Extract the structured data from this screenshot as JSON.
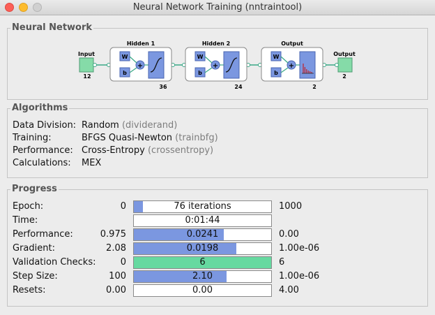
{
  "window": {
    "title": "Neural Network Training (nntraintool)"
  },
  "network": {
    "legend": "Neural Network",
    "input": {
      "label": "Input",
      "size": "12"
    },
    "layers": [
      {
        "label": "Hidden 1",
        "size": "36",
        "transfer": "sigmoid"
      },
      {
        "label": "Hidden 2",
        "size": "24",
        "transfer": "sigmoid"
      },
      {
        "label": "Output",
        "size": "2",
        "transfer": "softmax"
      }
    ],
    "output": {
      "label": "Output",
      "size": "2"
    },
    "weight_label": "W",
    "bias_label": "b",
    "colors": {
      "io_box": "#85dba8",
      "block": "#7b97e0",
      "connector": "#3aa886"
    }
  },
  "algorithms": {
    "legend": "Algorithms",
    "rows": [
      {
        "label": "Data Division:",
        "value": "Random",
        "fn": "(dividerand)"
      },
      {
        "label": "Training:",
        "value": "BFGS Quasi-Newton",
        "fn": "(trainbfg)"
      },
      {
        "label": "Performance:",
        "value": "Cross-Entropy",
        "fn": "(crossentropy)"
      },
      {
        "label": "Calculations:",
        "value": "MEX",
        "fn": ""
      }
    ]
  },
  "progress": {
    "legend": "Progress",
    "rows": [
      {
        "label": "Epoch:",
        "min": "0",
        "text": "76 iterations",
        "max": "1000",
        "fill": 0.076,
        "color": "#7b97e0"
      },
      {
        "label": "Time:",
        "min": "",
        "text": "0:01:44",
        "max": "",
        "fill": 0,
        "color": "#7b97e0"
      },
      {
        "label": "Performance:",
        "min": "0.975",
        "text": "0.0241",
        "max": "0.00",
        "fill": 0.66,
        "color": "#7b97e0"
      },
      {
        "label": "Gradient:",
        "min": "2.08",
        "text": "0.0198",
        "max": "1.00e-06",
        "fill": 0.75,
        "color": "#7b97e0"
      },
      {
        "label": "Validation Checks:",
        "min": "0",
        "text": "6",
        "max": "6",
        "fill": 1.0,
        "color": "#66d9a0"
      },
      {
        "label": "Step Size:",
        "min": "100",
        "text": "2.10",
        "max": "1.00e-06",
        "fill": 0.68,
        "color": "#7b97e0"
      },
      {
        "label": "Resets:",
        "min": "0.00",
        "text": "0.00",
        "max": "4.00",
        "fill": 0,
        "color": "#7b97e0"
      }
    ]
  }
}
